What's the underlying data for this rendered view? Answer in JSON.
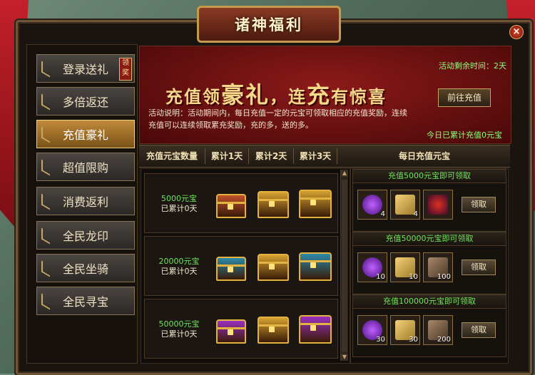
{
  "title": "诸神福利",
  "close_glyph": "×",
  "sidebar": {
    "items": [
      {
        "label": "登录送礼",
        "badge": "领奖"
      },
      {
        "label": "多倍返还"
      },
      {
        "label": "充值豪礼"
      },
      {
        "label": "超值限购"
      },
      {
        "label": "消费返利"
      },
      {
        "label": "全民龙印"
      },
      {
        "label": "全民坐骑"
      },
      {
        "label": "全民寻宝"
      }
    ],
    "active_index": 2
  },
  "banner": {
    "remaining": "活动剩余时间：2天",
    "slogan_a": "充值领",
    "slogan_b": "豪礼",
    "slogan_c": "，连",
    "slogan_d": "充",
    "slogan_e": "有惊喜",
    "goto_button": "前往充值",
    "description": "活动说明：活动期间内，每日充值一定的元宝可领取相应的充值奖励，连续充值可以连续领取累充奖励，充的多，送的多。",
    "today_total": "今日已累计充值0元宝"
  },
  "table_header": {
    "col_amount": "充值元宝数量",
    "col_day1": "累计1天",
    "col_day2": "累计2天",
    "col_day3": "累计3天",
    "col_daily": "每日充值元宝"
  },
  "rows": [
    {
      "amount": "5000元宝",
      "progress": "已累计0天",
      "chest_colors": [
        "#c0502a",
        "#d4a030",
        "#d4a030"
      ]
    },
    {
      "amount": "20000元宝",
      "progress": "已累计0天",
      "chest_colors": [
        "#2a8aa8",
        "#d4a030",
        "#2a8aa8"
      ]
    },
    {
      "amount": "50000元宝",
      "progress": "已累计0天",
      "chest_colors": [
        "#9a30c0",
        "#d4a030",
        "#9a30c0"
      ]
    }
  ],
  "daily": [
    {
      "header": "充值5000元宝即可领取",
      "items": [
        {
          "icon": "purple-orb-icon",
          "count": "4"
        },
        {
          "icon": "scroll-icon",
          "count": "4"
        },
        {
          "icon": "warrior-portrait-icon",
          "count": ""
        }
      ],
      "claim": "领取"
    },
    {
      "header": "充值50000元宝即可领取",
      "items": [
        {
          "icon": "purple-orb-icon",
          "count": "10"
        },
        {
          "icon": "scroll-icon",
          "count": "10"
        },
        {
          "icon": "wood-logs-icon",
          "count": "100"
        }
      ],
      "claim": "领取"
    },
    {
      "header": "充值100000元宝即可领取",
      "items": [
        {
          "icon": "purple-orb-icon",
          "count": "30"
        },
        {
          "icon": "scroll-icon",
          "count": "30"
        },
        {
          "icon": "wood-logs-icon",
          "count": "200"
        }
      ],
      "claim": "领取"
    }
  ]
}
